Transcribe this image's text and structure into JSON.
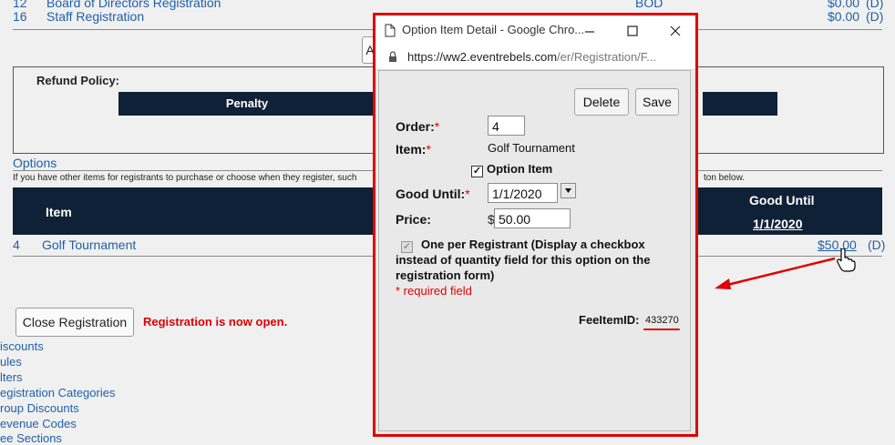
{
  "background": {
    "rows_top": [
      {
        "num": "12",
        "name": "Board of Directors Registration",
        "code": "BOD",
        "price": "$0.00",
        "flag": "(D)"
      },
      {
        "num": "16",
        "name": "Staff Registration",
        "code": "",
        "price": "$0.00",
        "flag": "(D)"
      }
    ],
    "add_button_label": "A",
    "refund": {
      "label": "Refund Policy:",
      "penalty_header": "Penalty"
    },
    "options": {
      "title": "Options",
      "desc_left": "If you have other items for registrants to purchase or choose when they register, such",
      "desc_right": "ton below.",
      "col_item": "Item",
      "col_good_until": "Good Until",
      "good_until_date": "1/1/2020",
      "row": {
        "num": "4",
        "name": "Golf Tournament",
        "price": "$50.00",
        "flag": "(D)"
      }
    },
    "close_registration_label": "Close Registration",
    "registration_status": "Registration is now open.",
    "left_links": [
      "iscounts",
      "ules",
      "lters",
      "egistration Categories",
      "roup Discounts",
      "evenue Codes",
      "ee Sections"
    ]
  },
  "popup": {
    "window_title": "Option Item Detail - Google Chro...",
    "url_domain": "https://ww2.eventrebels.com",
    "url_path": "/er/Registration/F...",
    "delete_label": "Delete",
    "save_label": "Save",
    "order_label": "Order:",
    "order_value": "4",
    "item_label": "Item:",
    "item_value": "Golf Tournament",
    "option_item_label": "Option Item",
    "good_until_label": "Good Until:",
    "good_until_value": "1/1/2020",
    "price_label": "Price:",
    "price_currency": "$",
    "price_value": "50.00",
    "one_per_registrant_label": "One per Registrant (Display a checkbox instead of quantity field for this option on the registration form)",
    "required_note": "* required field",
    "fee_item_label": "FeeItemID:",
    "fee_item_value": "433270",
    "required_mark": "*"
  },
  "colors": {
    "accent_red": "#e00000",
    "header_navy": "#0f2136",
    "link_blue": "#1f5fa8"
  }
}
